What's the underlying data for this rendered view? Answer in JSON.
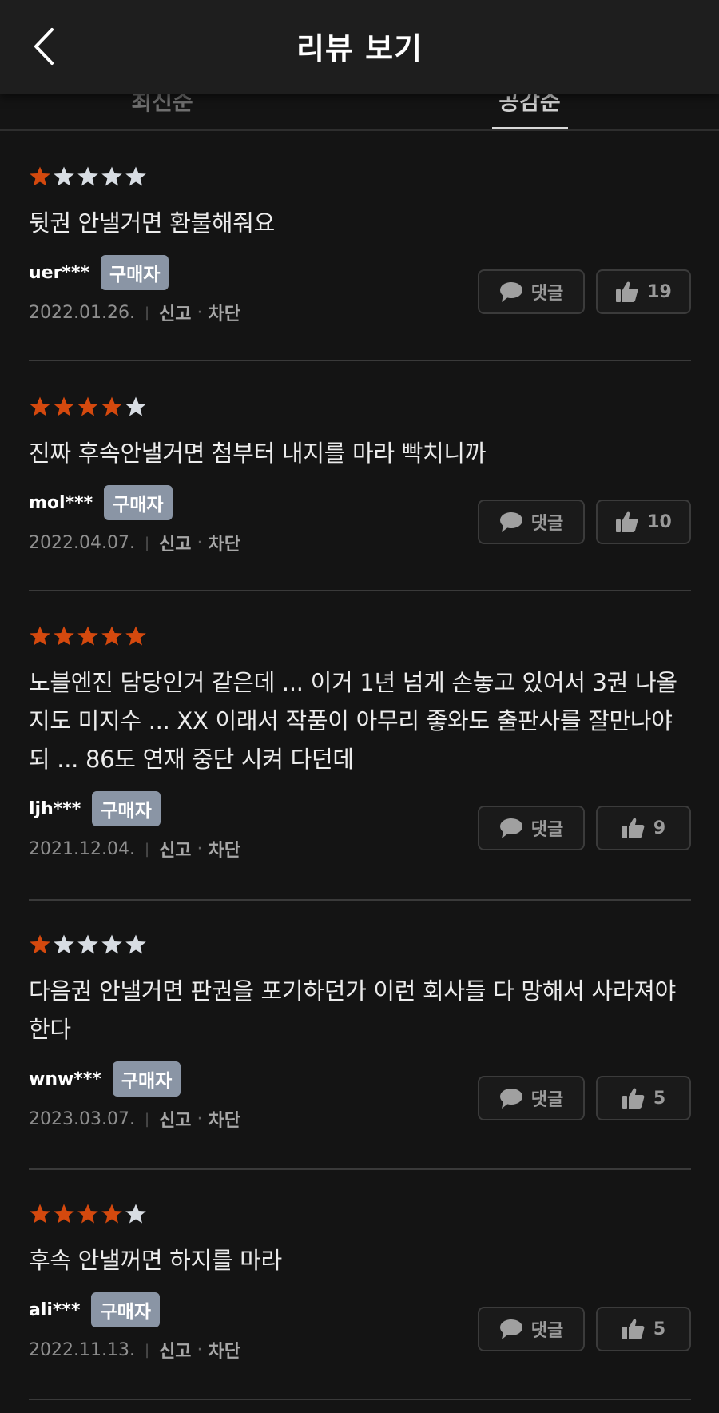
{
  "header": {
    "title": "리뷰 보기",
    "back_icon": "chevron-left-icon"
  },
  "tabs": [
    {
      "label": "최신순",
      "selected": false
    },
    {
      "label": "공감순",
      "selected": true
    }
  ],
  "colors": {
    "star_filled": "#d4490e",
    "star_empty": "#d8dde3",
    "badge": "#8a95a5"
  },
  "reviews": [
    {
      "rating": 1,
      "text": "뒷권 안낼거면 환불해줘요",
      "user": "uer***",
      "badge": "구매자",
      "date": "2022.01.26.",
      "report": "신고",
      "block": "차단",
      "comment_label": "댓글",
      "likes": "19"
    },
    {
      "rating": 4,
      "text": "진짜 후속안낼거면 첨부터 내지를 마라 빡치니까",
      "user": "mol***",
      "badge": "구매자",
      "date": "2022.04.07.",
      "report": "신고",
      "block": "차단",
      "comment_label": "댓글",
      "likes": "10"
    },
    {
      "rating": 5,
      "text": "노블엔진 담당인거 같은데 ... 이거 1년 넘게 손놓고 있어서 3권 나올지도 미지수 ... XX 이래서 작품이 아무리 좋와도 출판사를 잘만나야되 ... 86도 연재 중단 시켜 다던데",
      "user": "ljh***",
      "badge": "구매자",
      "date": "2021.12.04.",
      "report": "신고",
      "block": "차단",
      "comment_label": "댓글",
      "likes": "9"
    },
    {
      "rating": 1,
      "text": "다음권 안낼거면 판권을 포기하던가 이런 회사들 다 망해서 사라져야 한다",
      "user": "wnw***",
      "badge": "구매자",
      "date": "2023.03.07.",
      "report": "신고",
      "block": "차단",
      "comment_label": "댓글",
      "likes": "5"
    },
    {
      "rating": 4,
      "text": "후속 안낼꺼면 하지를 마라",
      "user": "ali***",
      "badge": "구매자",
      "date": "2022.11.13.",
      "report": "신고",
      "block": "차단",
      "comment_label": "댓글",
      "likes": "5"
    }
  ]
}
